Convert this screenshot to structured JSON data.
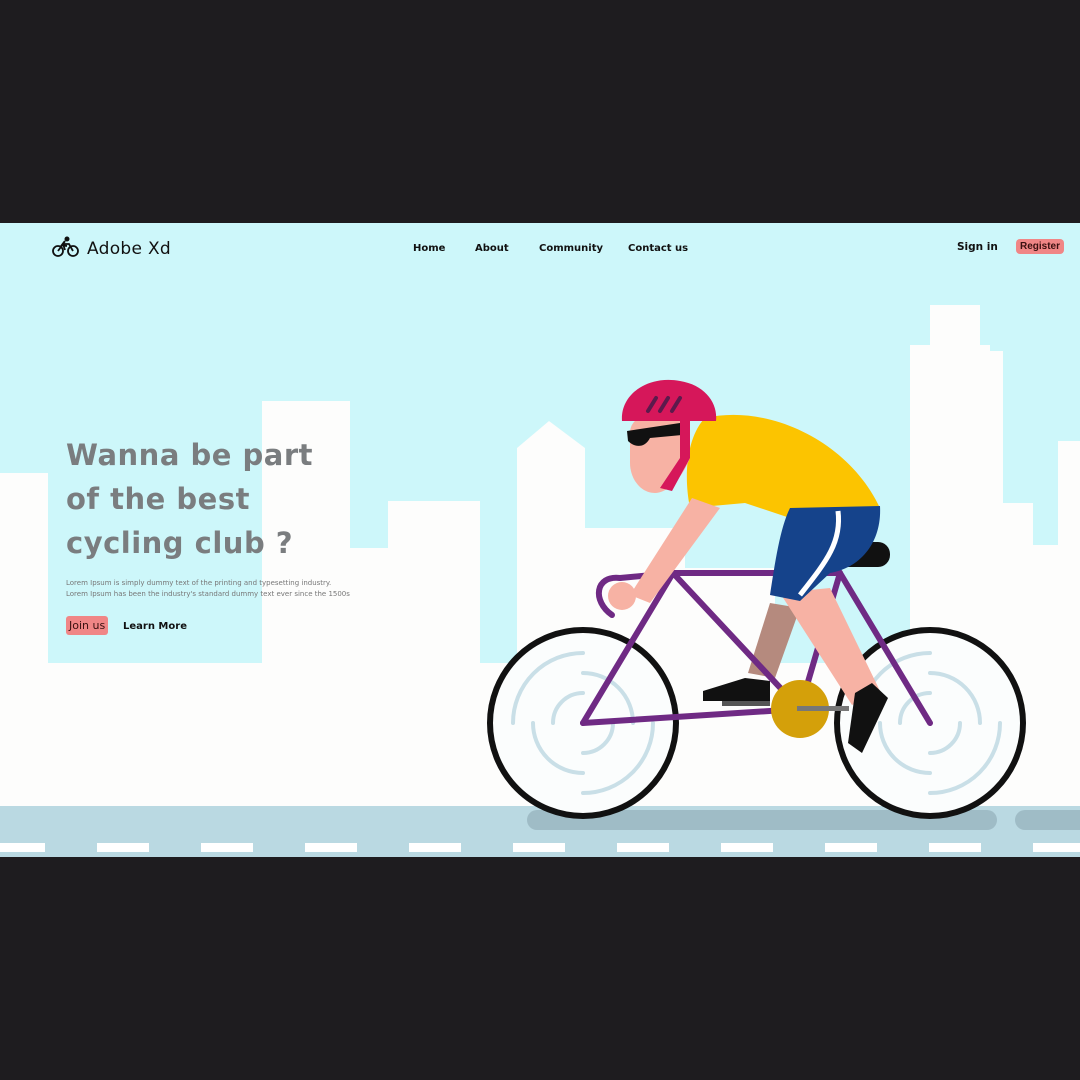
{
  "brand": {
    "name": "Adobe Xd",
    "logo_icon": "bicycle-rider-icon"
  },
  "nav": {
    "links": [
      {
        "label": "Home"
      },
      {
        "label": "About"
      },
      {
        "label": "Community"
      },
      {
        "label": "Contact us"
      }
    ],
    "sign_in": "Sign in",
    "register": "Register"
  },
  "hero": {
    "headline_lines": [
      "Wanna be part",
      "of the best",
      "cycling club ?"
    ],
    "description_lines": [
      "Lorem Ipsum is simply dummy text of the printing and typesetting industry.",
      "Lorem Ipsum has been the industry's standard dummy text ever since the 1500s"
    ],
    "join_label": "Join us",
    "learn_label": "Learn More"
  },
  "colors": {
    "sky": "#cdf7fa",
    "letterbox": "#1e1c1f",
    "accent": "#f08686",
    "helmet": "#d6175a",
    "jersey": "#fcc400",
    "shorts": "#15438b",
    "bike_frame": "#6f2a84",
    "road": "#bad9e2"
  }
}
